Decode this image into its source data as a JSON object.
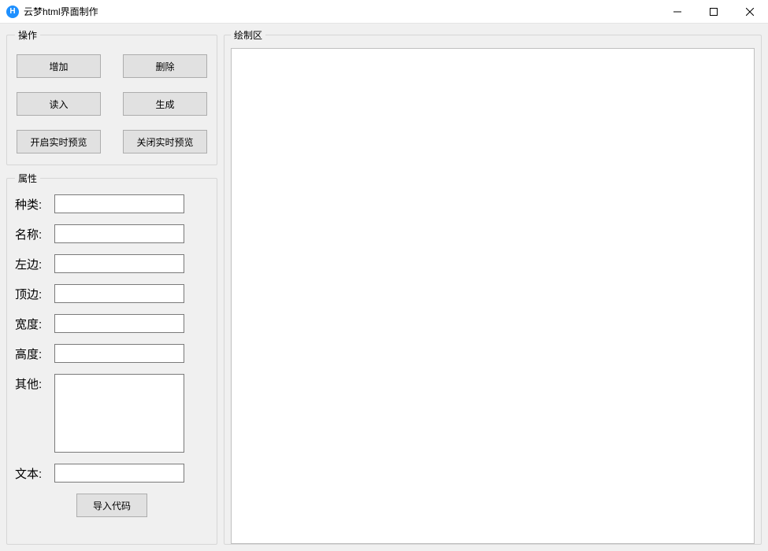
{
  "window": {
    "title": "云梦html界面制作",
    "icon_letter": "H"
  },
  "ops": {
    "legend": "操作",
    "buttons": {
      "add": "增加",
      "delete": "删除",
      "load": "读入",
      "generate": "生成",
      "start_preview": "开启实时预览",
      "stop_preview": "关闭实时预览"
    }
  },
  "props": {
    "legend": "属性",
    "labels": {
      "type": "种类:",
      "name": "名称:",
      "left": "左边:",
      "top": "顶边:",
      "width": "宽度:",
      "height": "高度:",
      "other": "其他:",
      "text": "文本:"
    },
    "values": {
      "type": "",
      "name": "",
      "left": "",
      "top": "",
      "width": "",
      "height": "",
      "other": "",
      "text": ""
    },
    "import_button": "导入代码"
  },
  "draw": {
    "legend": "绘制区"
  }
}
